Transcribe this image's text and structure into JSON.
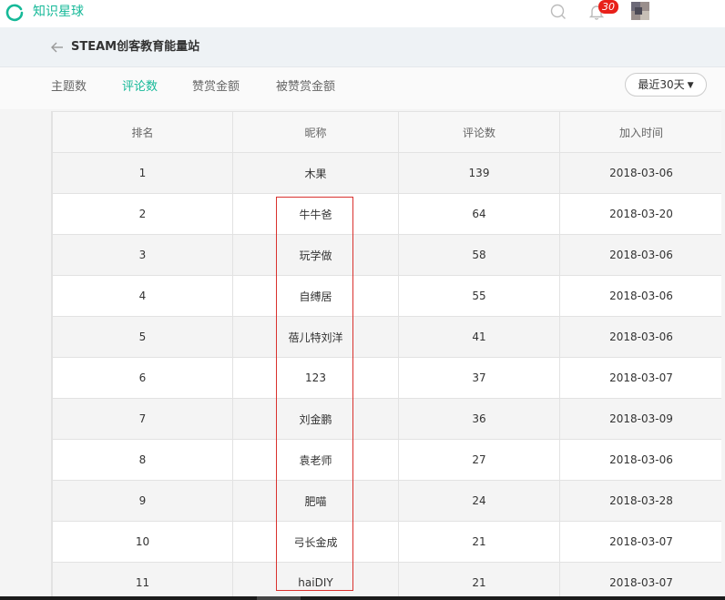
{
  "app": {
    "brand": "知识星球",
    "notifications_count": "30"
  },
  "header": {
    "title": "STEAM创客教育能量站"
  },
  "tabs": [
    {
      "label": "主题数"
    },
    {
      "label": "评论数",
      "active": true
    },
    {
      "label": "赞赏金额"
    },
    {
      "label": "被赞赏金额"
    }
  ],
  "range": {
    "label": "最近30天"
  },
  "table": {
    "columns": [
      "排名",
      "昵称",
      "评论数",
      "加入时间"
    ],
    "rows": [
      [
        "1",
        "木果",
        "139",
        "2018-03-06"
      ],
      [
        "2",
        "牛牛爸",
        "64",
        "2018-03-20"
      ],
      [
        "3",
        "玩学做",
        "58",
        "2018-03-06"
      ],
      [
        "4",
        "自缚居",
        "55",
        "2018-03-06"
      ],
      [
        "5",
        "蓓儿特刘洋",
        "41",
        "2018-03-06"
      ],
      [
        "6",
        "123",
        "37",
        "2018-03-07"
      ],
      [
        "7",
        "刘金鹏",
        "36",
        "2018-03-09"
      ],
      [
        "8",
        "袁老师",
        "27",
        "2018-03-06"
      ],
      [
        "9",
        "肥喵",
        "24",
        "2018-03-28"
      ],
      [
        "10",
        "弓长金成",
        "21",
        "2018-03-07"
      ],
      [
        "11",
        "haiDIY",
        "21",
        "2018-03-07"
      ]
    ]
  },
  "colors": {
    "accent": "#16b998",
    "badge": "#e8201a",
    "highlight": "#d9322e"
  }
}
